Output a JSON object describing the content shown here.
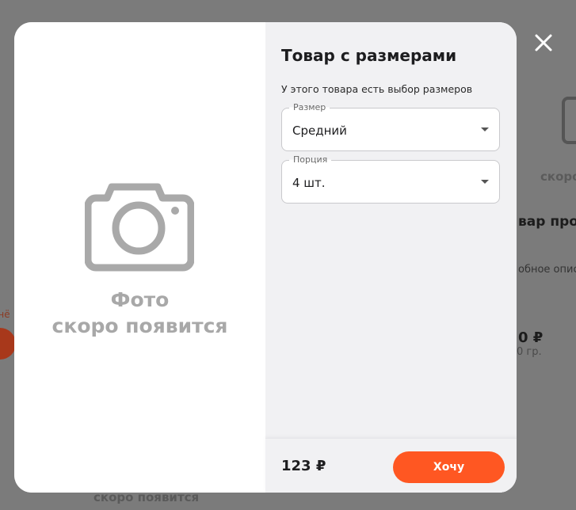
{
  "background": {
    "left_link": "онё",
    "bottom_soon": "скоро появится",
    "card2_soon": "скоро",
    "card2_title": "вар про",
    "card2_desc": "обное опис",
    "card2_price": "0 ₽",
    "card2_weight": "0 гр."
  },
  "modal": {
    "placeholder": {
      "line1": "Фото",
      "line2": "скоро появится"
    },
    "title": "Товар с размерами",
    "subtitle": "У этого товара есть выбор размеров",
    "size_select": {
      "label": "Размер",
      "value": "Средний"
    },
    "portion_select": {
      "label": "Порция",
      "value": "4 шт."
    },
    "price": "123 ₽",
    "want_button": "Хочу"
  },
  "colors": {
    "accent": "#ff5722",
    "overlay": "#7b7b7b",
    "panel": "#f1f1f3"
  },
  "icons": {
    "close": "close-icon",
    "placeholder": "camera-icon"
  }
}
